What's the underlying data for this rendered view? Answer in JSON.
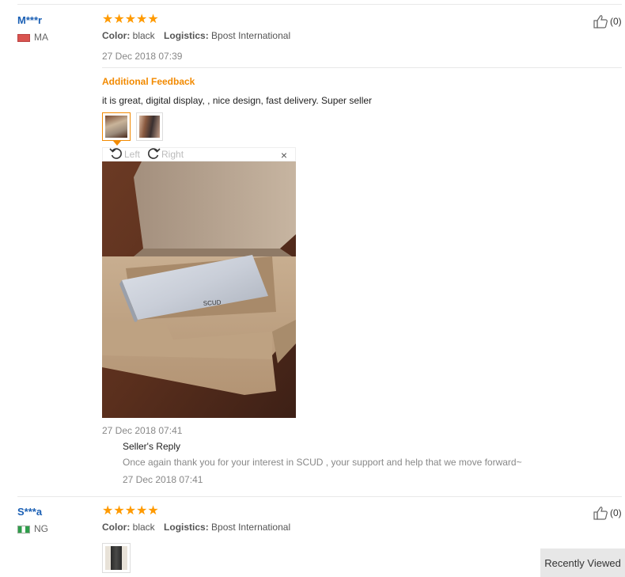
{
  "reviews": [
    {
      "user": "M***r",
      "country": "MA",
      "flag": "flag-ma",
      "stars": "★★★★★",
      "color_label": "Color:",
      "color_value": "black",
      "logistics_label": "Logistics:",
      "logistics_value": "Bpost International",
      "date": "27 Dec 2018 07:39",
      "likes": "(0)",
      "additional_feedback_title": "Additional Feedback",
      "additional_feedback_text": "it is great, digital display, , nice design, fast delivery. Super seller",
      "additional_feedback_date": "27 Dec 2018 07:41",
      "viewer": {
        "left_label": "Left",
        "right_label": "Right",
        "close_glyph": "×"
      },
      "photo_brand": "SCUD",
      "seller_reply_title": "Seller's Reply",
      "seller_reply_text": "Once again thank you for your interest in SCUD , your support and help that we move forward~",
      "seller_reply_date": "27 Dec 2018 07:41"
    },
    {
      "user": "S***a",
      "country": "NG",
      "flag": "flag-ng",
      "stars": "★★★★★",
      "color_label": "Color:",
      "color_value": "black",
      "logistics_label": "Logistics:",
      "logistics_value": "Bpost International",
      "likes": "(0)"
    }
  ],
  "recently_viewed": "Recently Viewed",
  "colors": {
    "accent_orange": "#f28a00",
    "star": "#ff9a00",
    "username_blue": "#1a5fb4"
  }
}
